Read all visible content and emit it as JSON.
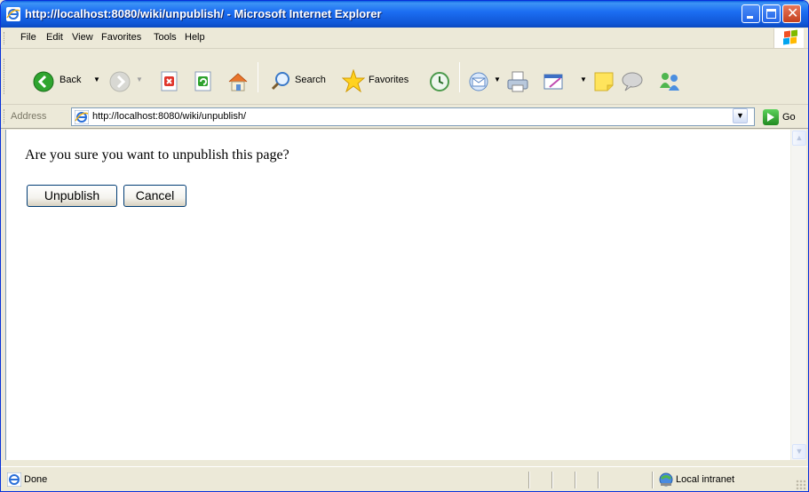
{
  "window": {
    "title": "http://localhost:8080/wiki/unpublish/ - Microsoft Internet Explorer"
  },
  "menu": {
    "items": [
      "File",
      "Edit",
      "View",
      "Favorites",
      "Tools",
      "Help"
    ]
  },
  "toolbar": {
    "back_label": "Back",
    "search_label": "Search",
    "favorites_label": "Favorites"
  },
  "address": {
    "label": "Address",
    "url": "http://localhost:8080/wiki/unpublish/",
    "go_label": "Go"
  },
  "page": {
    "prompt": "Are you sure you want to unpublish this page?",
    "unpublish_button": "Unpublish",
    "cancel_button": "Cancel"
  },
  "status": {
    "text": "Done",
    "zone": "Local intranet"
  },
  "colors": {
    "titlebar": "#0f56d6",
    "window_bg": "#ece9d8",
    "content_bg": "#ffffff",
    "button_border": "#003c74"
  }
}
